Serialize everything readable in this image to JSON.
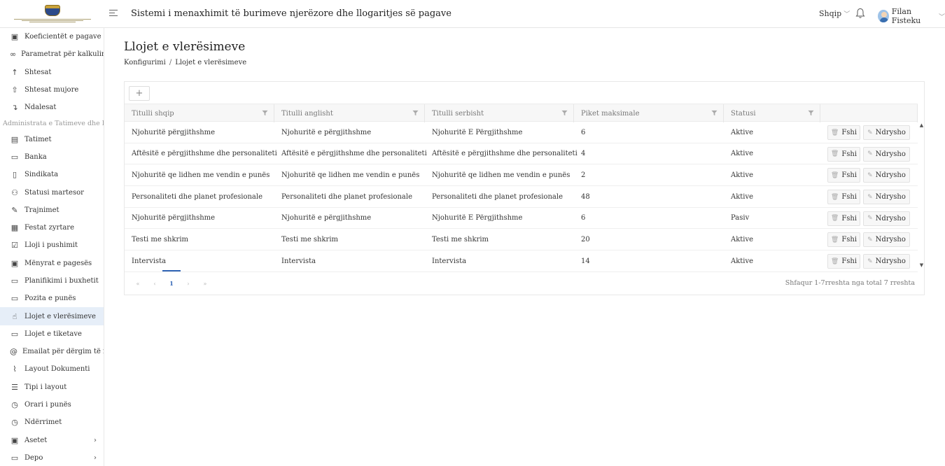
{
  "header": {
    "title": "Sistemi i menaxhimit të burimeve njerëzore dhe llogaritjes së pagave",
    "language": "Shqip",
    "user_name": "Filan Fisteku"
  },
  "sidebar": {
    "items_top": [
      {
        "label": "Koeficientët e pagave",
        "icon": "money-icon",
        "glyph": "▣"
      },
      {
        "label": "Parametrat për kalkulim",
        "icon": "link-icon",
        "glyph": "∞"
      },
      {
        "label": "Shtesat",
        "icon": "arrow-up-icon",
        "glyph": "↑"
      },
      {
        "label": "Shtesat mujore",
        "icon": "upload-icon",
        "glyph": "⇧"
      },
      {
        "label": "Ndalesat",
        "icon": "arrow-down-right-icon",
        "glyph": "↴"
      }
    ],
    "group_label": "Administrata e Tatimeve dhe Bank",
    "items_bottom": [
      {
        "label": "Tatimet",
        "icon": "table-icon",
        "glyph": "▤"
      },
      {
        "label": "Banka",
        "icon": "wallet-icon",
        "glyph": "▭"
      },
      {
        "label": "Sindikata",
        "icon": "document-icon",
        "glyph": "▯"
      },
      {
        "label": "Statusi martesor",
        "icon": "users-icon",
        "glyph": "⚇"
      },
      {
        "label": "Trajnimet",
        "icon": "edit-icon",
        "glyph": "✎"
      },
      {
        "label": "Festat zyrtare",
        "icon": "calendar-icon",
        "glyph": "▦"
      },
      {
        "label": "Lloji i pushimit",
        "icon": "checkbox-calendar-icon",
        "glyph": "☑"
      },
      {
        "label": "Mënyrat e pagesës",
        "icon": "cash-icon",
        "glyph": "▣"
      },
      {
        "label": "Planifikimi i buxhetit",
        "icon": "briefcase-icon",
        "glyph": "▭"
      },
      {
        "label": "Pozita e punës",
        "icon": "briefcase-icon",
        "glyph": "▭"
      },
      {
        "label": "Llojet e vlerësimeve",
        "icon": "like-icon",
        "glyph": "☝",
        "active": true
      },
      {
        "label": "Llojet e tiketave",
        "icon": "ticket-icon",
        "glyph": "▭"
      },
      {
        "label": "Emailat për dërgim të rapo",
        "icon": "at-icon",
        "glyph": "@"
      },
      {
        "label": "Layout Dokumenti",
        "icon": "paperclip-icon",
        "glyph": "⌇"
      },
      {
        "label": "Tipi i layout",
        "icon": "ordered-list-icon",
        "glyph": "☰"
      },
      {
        "label": "Orari i punës",
        "icon": "clock-icon",
        "glyph": "◷"
      },
      {
        "label": "Ndërrimet",
        "icon": "clock-icon",
        "glyph": "◷"
      },
      {
        "label": "Asetet",
        "icon": "money-icon",
        "glyph": "▣",
        "has_children": true
      },
      {
        "label": "Depo",
        "icon": "hdd-icon",
        "glyph": "▭",
        "has_children": true
      }
    ]
  },
  "page": {
    "title": "Llojet e vlerësimeve",
    "breadcrumb": [
      "Konfigurimi",
      "Llojet e vlerësimeve"
    ],
    "breadcrumb_sep": "/"
  },
  "table": {
    "add_label": "+",
    "columns": [
      "Titulli shqip",
      "Titulli anglisht",
      "Titulli serbisht",
      "Piket maksimale",
      "Statusi"
    ],
    "rows": [
      {
        "sq": "Njohuritë përgjithshme",
        "en": "Njohuritë e përgjithshme",
        "sr": "Njohuritë E Përgjithshme",
        "max": "6",
        "status": "Aktive"
      },
      {
        "sq": "Aftësitë e përgjithshme dhe personaliteti",
        "en": "Aftësitë e përgjithshme dhe personaliteti",
        "sr": "Aftësitë e përgjithshme dhe personaliteti",
        "max": "4",
        "status": "Aktive"
      },
      {
        "sq": "Njohuritë qe lidhen me vendin e punës",
        "en": "Njohuritë qe lidhen me vendin e punës",
        "sr": "Njohuritë qe lidhen me vendin e punës",
        "max": "2",
        "status": "Aktive"
      },
      {
        "sq": "Personaliteti dhe planet profesionale",
        "en": "Personaliteti dhe planet profesionale",
        "sr": "Personaliteti dhe planet profesionale",
        "max": "48",
        "status": "Aktive"
      },
      {
        "sq": "Njohuritë përgjithshme",
        "en": "Njohuritë e përgjithshme",
        "sr": "Njohuritë E Përgjithshme",
        "max": "6",
        "status": "Pasiv"
      },
      {
        "sq": "Testi me shkrim",
        "en": "Testi me shkrim",
        "sr": "Testi me shkrim",
        "max": "20",
        "status": "Aktive"
      },
      {
        "sq": "Intervista",
        "en": "Intervista",
        "sr": "Intervista",
        "max": "14",
        "status": "Aktive"
      }
    ],
    "delete_label": "Fshi",
    "edit_label": "Ndrysho"
  },
  "pagination": {
    "first": "«",
    "prev": "‹",
    "current": "1",
    "next": "›",
    "last": "»",
    "info": "Shfaqur 1-7rreshta nga total 7 rreshta"
  }
}
